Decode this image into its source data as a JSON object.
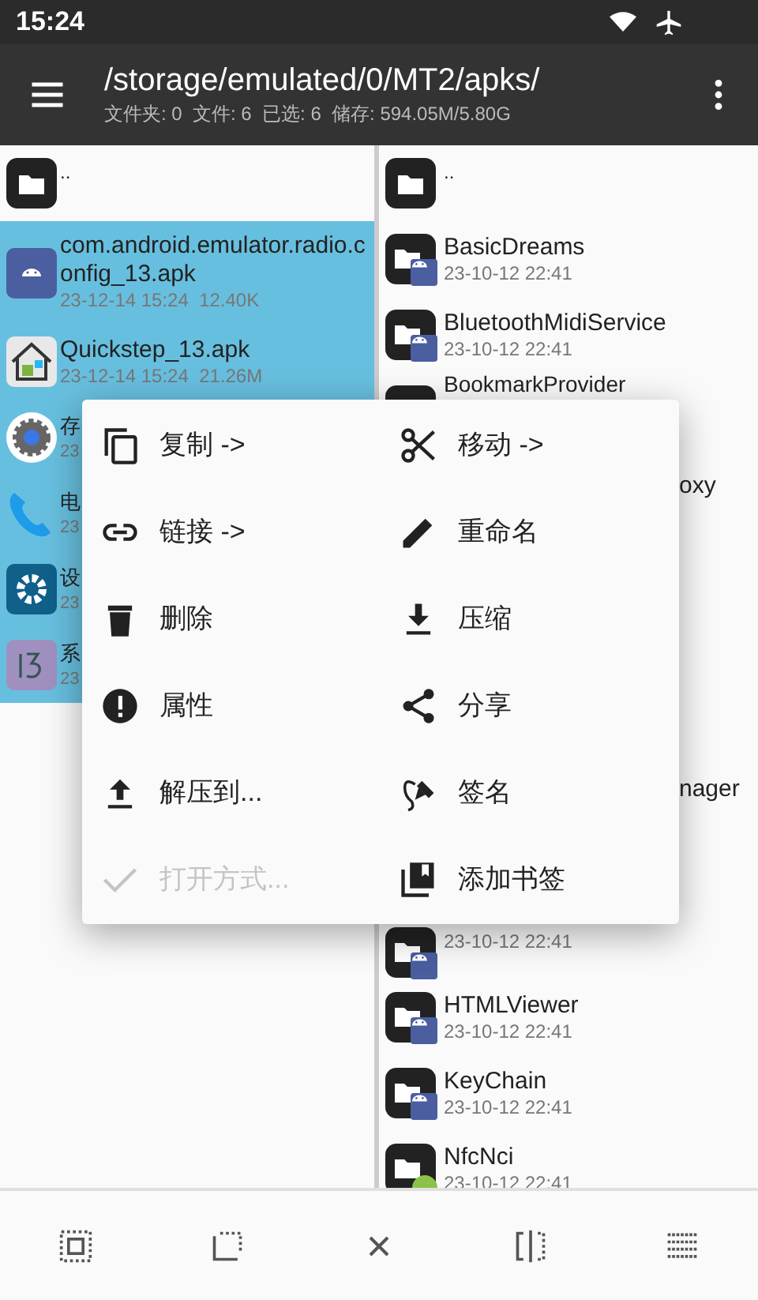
{
  "status_bar": {
    "time": "15:24"
  },
  "toolbar": {
    "path": "/storage/emulated/0/MT2/apks/",
    "summary": "文件夹: 0  文件: 6  已选: 6  储存: 594.05M/5.80G"
  },
  "left_panel": {
    "items": [
      {
        "kind": "parent",
        "name": "..",
        "selected": false
      },
      {
        "kind": "android",
        "name": "com.android.emulator.radio.config_13.apk",
        "meta": "23-12-14 15:24  12.40K",
        "selected": true
      },
      {
        "kind": "house",
        "name": "Quickstep_13.apk",
        "meta": "23-12-14 15:24  21.26M",
        "selected": true
      },
      {
        "kind": "gear",
        "name": "存",
        "meta": "23",
        "selected": true
      },
      {
        "kind": "phone",
        "name": "电",
        "meta": "23",
        "selected": true
      },
      {
        "kind": "settings",
        "name": "设",
        "meta": "23",
        "selected": true
      },
      {
        "kind": "version",
        "name": "系",
        "meta": "23",
        "selected": true
      }
    ]
  },
  "right_panel": {
    "items": [
      {
        "kind": "parent",
        "name": ".."
      },
      {
        "kind": "app",
        "name": "BasicDreams",
        "meta": "23-10-12 22:41"
      },
      {
        "kind": "app",
        "name": "BluetoothMidiService",
        "meta": "23-10-12 22:41"
      },
      {
        "kind": "app",
        "name": "BookmarkProvider"
      },
      {
        "kind": "covered",
        "tail": "oxy"
      },
      {
        "kind": "covered"
      },
      {
        "kind": "covered"
      },
      {
        "kind": "covered"
      },
      {
        "kind": "covered",
        "tail": "nager"
      },
      {
        "kind": "covered"
      },
      {
        "kind": "app",
        "meta": "23-10-12 22:41"
      },
      {
        "kind": "app",
        "name": "HTMLViewer",
        "meta": "23-10-12 22:41"
      },
      {
        "kind": "app",
        "name": "KeyChain",
        "meta": "23-10-12 22:41"
      },
      {
        "kind": "greenapp",
        "name": "NfcNci",
        "meta": "23-10-12 22:41"
      }
    ]
  },
  "menu": {
    "items": [
      {
        "kind": "copy",
        "label": "复制 ->",
        "disabled": false
      },
      {
        "kind": "cut",
        "label": "移动 ->",
        "disabled": false
      },
      {
        "kind": "link",
        "label": "链接 ->",
        "disabled": false
      },
      {
        "kind": "pencil",
        "label": "重命名",
        "disabled": false
      },
      {
        "kind": "trash",
        "label": "删除",
        "disabled": false
      },
      {
        "kind": "download",
        "label": "压缩",
        "disabled": false
      },
      {
        "kind": "info",
        "label": "属性",
        "disabled": false
      },
      {
        "kind": "share",
        "label": "分享",
        "disabled": false
      },
      {
        "kind": "upload",
        "label": "解压到...",
        "disabled": false
      },
      {
        "kind": "sign",
        "label": "签名",
        "disabled": false
      },
      {
        "kind": "check",
        "label": "打开方式...",
        "disabled": true
      },
      {
        "kind": "bookmark",
        "label": "添加书签",
        "disabled": false
      }
    ]
  },
  "bottom_bar": {
    "buttons": [
      {
        "kind": "selectall"
      },
      {
        "kind": "selectrange"
      },
      {
        "kind": "close"
      },
      {
        "kind": "split"
      },
      {
        "kind": "list"
      }
    ]
  }
}
